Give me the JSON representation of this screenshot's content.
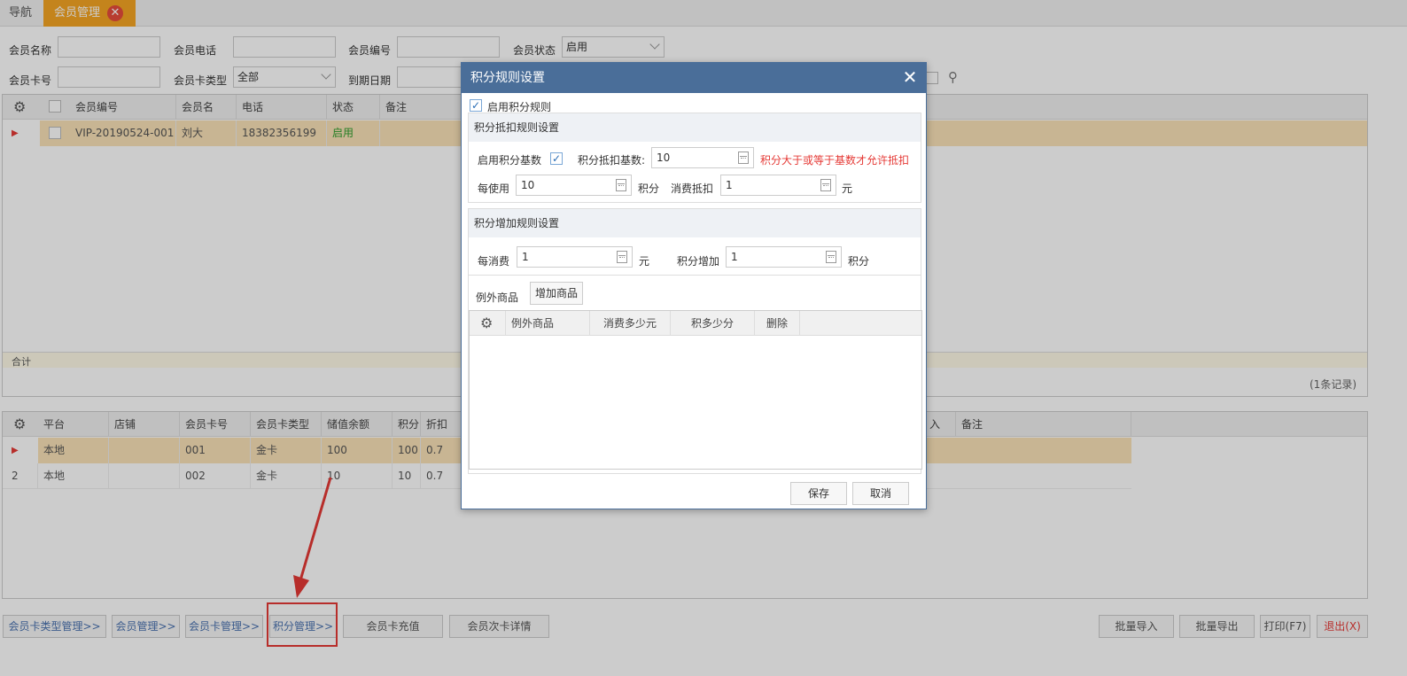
{
  "tabs": {
    "nav": "导航",
    "active": "会员管理",
    "close": "✕"
  },
  "filters": {
    "member_name": "会员名称",
    "member_phone": "会员电话",
    "member_no": "会员编号",
    "member_status": "会员状态",
    "status_value": "启用",
    "card_no": "会员卡号",
    "card_type": "会员卡类型",
    "card_type_value": "全部",
    "expire_date": "到期日期"
  },
  "member_grid": {
    "headers": [
      "会员编号",
      "会员名",
      "电话",
      "状态",
      "备注"
    ],
    "rows": [
      {
        "no": "VIP-20190524-001",
        "name": "刘大",
        "phone": "18382356199",
        "status": "启用"
      }
    ],
    "total_label": "合计",
    "record_count": "(1条记录)"
  },
  "card_grid": {
    "headers": [
      "平台",
      "店铺",
      "会员卡号",
      "会员卡类型",
      "储值余额",
      "积分",
      "折扣"
    ],
    "headers_right": [
      "入",
      "备注"
    ],
    "rows": [
      {
        "idx": "",
        "platform": "本地",
        "shop": "",
        "card_no": "001",
        "card_type": "金卡",
        "balance": "100",
        "points": "100",
        "discount": "0.7"
      },
      {
        "idx": "2",
        "platform": "本地",
        "shop": "",
        "card_no": "002",
        "card_type": "金卡",
        "balance": "10",
        "points": "10",
        "discount": "0.7"
      }
    ]
  },
  "bottom_buttons": {
    "card_type_mgmt": "会员卡类型管理>>",
    "member_mgmt": "会员管理>>",
    "card_mgmt": "会员卡管理>>",
    "points_mgmt": "积分管理>>",
    "card_recharge": "会员卡充值",
    "card_times_detail": "会员次卡详情",
    "batch_import": "批量导入",
    "batch_export": "批量导出",
    "print": "打印(F7)",
    "exit": "退出(X)"
  },
  "dialog": {
    "title": "积分规则设置",
    "enable_rule": "启用积分规则",
    "deduct_section": "积分抵扣规则设置",
    "enable_base": "启用积分基数",
    "base_label": "积分抵扣基数:",
    "base_value": "10",
    "base_hint": "积分大于或等于基数才允许抵扣",
    "per_use": "每使用",
    "per_use_value": "10",
    "points_unit": "积分",
    "deduct_label": "消费抵扣",
    "deduct_value": "1",
    "yuan_unit": "元",
    "add_section": "积分增加规则设置",
    "per_consume": "每消费",
    "per_consume_value": "1",
    "add_label": "积分增加",
    "add_value": "1",
    "except_label": "例外商品",
    "add_goods": "增加商品",
    "except_headers": [
      "例外商品",
      "消费多少元",
      "积多少分",
      "删除"
    ],
    "save": "保存",
    "cancel": "取消"
  }
}
